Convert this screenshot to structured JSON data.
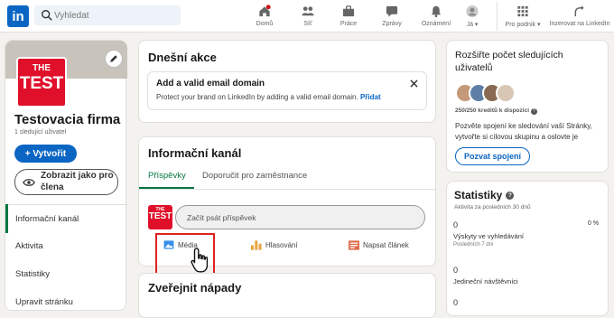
{
  "topbar": {
    "logo_text": "in",
    "search_placeholder": "Vyhledat",
    "nav": [
      {
        "label": "Domů",
        "icon": "home-icon"
      },
      {
        "label": "Síť",
        "icon": "network-icon"
      },
      {
        "label": "Práce",
        "icon": "briefcase-icon"
      },
      {
        "label": "Zprávy",
        "icon": "messages-icon"
      },
      {
        "label": "Oznámení",
        "icon": "bell-icon"
      },
      {
        "label": "Já",
        "icon": "avatar-icon"
      },
      {
        "label": "Pro podnik",
        "icon": "grid-icon"
      },
      {
        "label": "Inzerovat na LinkedIn",
        "icon": "advertise-icon"
      }
    ]
  },
  "sidebar": {
    "logo_line1": "THE",
    "logo_line2": "TEST",
    "company_name": "Testovacia firma",
    "followers": "1 sledující uživatel",
    "create_button": "+ Vytvořit",
    "view_as_member_line1": "Zobrazit jako pro",
    "view_as_member_line2": "člena",
    "items": [
      "Informační kanál",
      "Aktivita",
      "Statistiky",
      "Upravit stránku"
    ]
  },
  "today": {
    "title": "Dnešní akce",
    "notice_title": "Add a valid email domain",
    "notice_text": "Protect your brand on LinkedIn by adding a valid email domain.",
    "notice_link": "Přidat"
  },
  "feed": {
    "title": "Informační kanál",
    "tabs": [
      "Příspěvky",
      "Doporučit pro zaměstnance"
    ],
    "composer_placeholder": "Začít psát příspěvek",
    "actions": [
      "Média",
      "Hlasování",
      "Napsat článek"
    ]
  },
  "ideas": {
    "title": "Zveřejnit nápady"
  },
  "grow": {
    "title_line1": "Rozšiřte počet sledujících",
    "title_line2": "uživatelů",
    "credits": "250/250 kreditů k dispozici",
    "text_line1": "Pozvěte spojení ke sledování vaší Stránky,",
    "text_line2": "vytvořte si cílovou skupinu a oslovte je",
    "invite_button": "Pozvat spojení"
  },
  "stats": {
    "title": "Statistiky",
    "period": "Aktivita za posledních 30 dnů",
    "search_value": "0",
    "search_change": "0 %",
    "search_label": "Výskyty ve vyhledávání",
    "search_sub": "Posledních 7 dní",
    "visitors_value": "0",
    "visitors_label": "Jedineční návštěvníci",
    "third_value": "0"
  },
  "colors": {
    "accent": "#0a66c2",
    "brand_red": "#e0102b",
    "highlight": "#e02020"
  }
}
